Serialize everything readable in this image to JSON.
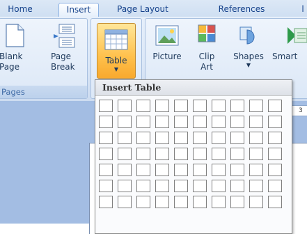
{
  "tabs": [
    {
      "label": "Home",
      "active": false
    },
    {
      "label": "Insert",
      "active": true
    },
    {
      "label": "Page Layout",
      "active": false
    },
    {
      "label": "References",
      "active": false
    },
    {
      "label": "l",
      "active": false
    }
  ],
  "ribbon": {
    "pages_group": {
      "label": "Pages",
      "buttons": [
        {
          "label": "Blank\nPage",
          "icon": "blank-page-icon"
        },
        {
          "label": "Page\nBreak",
          "icon": "page-break-icon"
        }
      ]
    },
    "tables_group": {
      "button": {
        "label": "Table",
        "icon": "table-icon",
        "pressed": true
      }
    },
    "illustrations_group": {
      "buttons": [
        {
          "label": "Picture",
          "icon": "picture-icon"
        },
        {
          "label": "Clip\nArt",
          "icon": "clip-art-icon"
        },
        {
          "label": "Shapes",
          "icon": "shapes-icon"
        },
        {
          "label": "Smart",
          "icon": "smartart-icon"
        }
      ]
    }
  },
  "ruler": {
    "left_mark": "I",
    "right_mark": "3"
  },
  "insert_table": {
    "title": "Insert Table",
    "columns": 10,
    "rows": 7
  },
  "colors": {
    "accent_pressed": "#ffc14d",
    "ribbon_bg": "#dbe7f7",
    "tab_text": "#15428b",
    "doc_bg": "#a3bde3"
  }
}
